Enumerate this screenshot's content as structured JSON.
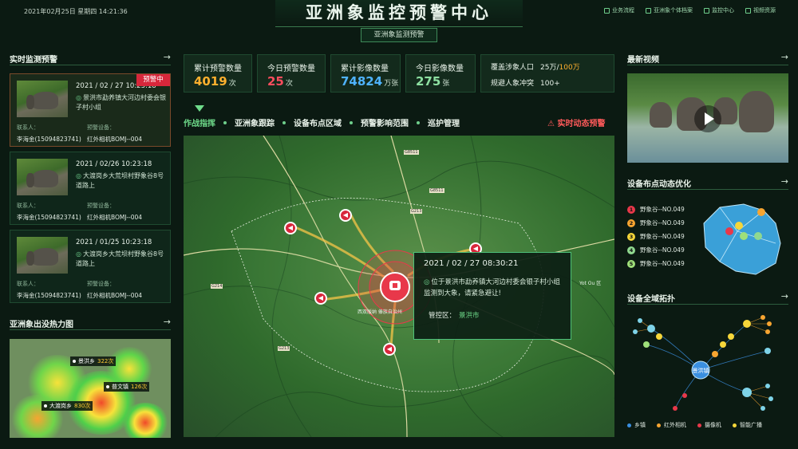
{
  "header": {
    "datetime": "2021年02月25日 星期四 14:21:36",
    "title": "亚洲象监控预警中心",
    "subtitle": "亚洲象监测预警",
    "links": [
      "业务流程",
      "亚洲象个体档案",
      "监控中心",
      "视频资源"
    ]
  },
  "left": {
    "alerts_title": "实时监测预警",
    "alerts": [
      {
        "date": "2021 / 02 / 27  10:23:18",
        "badge": "预警中",
        "location": "景洪市勐养镇大河边村委会银子村小组",
        "contact_label": "联系人：",
        "contact": "李海金(15094823741)",
        "device_label": "预警设备：",
        "device": "红外相机BOMJ--004"
      },
      {
        "date": "2021 / 02/26  10:23:18",
        "badge": "",
        "location": "大渡岗乡大荒坝村野象谷8号道路上",
        "contact_label": "联系人：",
        "contact": "李海金(15094823741)",
        "device_label": "预警设备：",
        "device": "红外相机BOMJ--004"
      },
      {
        "date": "2021 / 01/25  10:23:18",
        "badge": "",
        "location": "大渡岗乡大荒坝村野象谷8号道路上",
        "contact_label": "联系人：",
        "contact": "李海金(15094823741)",
        "device_label": "预警设备：",
        "device": "红外相机BOMJ--004"
      }
    ],
    "heat_title": "亚洲象出没热力图",
    "heat_tags": [
      {
        "name": "景洪乡",
        "count": "322次"
      },
      {
        "name": "普文镇",
        "count": "126次"
      },
      {
        "name": "大渡岗乡",
        "count": "830次"
      }
    ]
  },
  "stats": [
    {
      "label": "累计预警数量",
      "value": "4019",
      "unit": "次",
      "color": "orange"
    },
    {
      "label": "今日预警数量",
      "value": "25",
      "unit": "次",
      "color": "red"
    },
    {
      "label": "累计影像数量",
      "value": "74824",
      "unit": "万张",
      "color": "blue"
    },
    {
      "label": "今日影像数量",
      "value": "275",
      "unit": "张",
      "color": "green"
    }
  ],
  "coverage": {
    "row1_label": "覆盖涉象人口",
    "row1_value": "25万",
    "row1_total": "100万",
    "row2_label": "规避人象冲突",
    "row2_value": "100+"
  },
  "tabs": [
    "作战指挥",
    "亚洲象跟踪",
    "设备布点区域",
    "预警影响范围",
    "巡护管理"
  ],
  "realtime_label": "实时动态预警",
  "popup": {
    "date": "2021 / 02 / 27  08:30:21",
    "message": "位于景洪市勐养镇大河边村委会银子村小组监测到大象，请紧急避让!",
    "zone_label": "管控区：",
    "zone_value": "景洪市"
  },
  "map_labels": {
    "city": "西双版纳 傣族自治州",
    "town": "Yot Ou 区"
  },
  "right": {
    "video_title": "最新视频",
    "devices_title": "设备布点动态优化",
    "devices": [
      {
        "num": "1",
        "name": "野象谷--NO.049",
        "color": "#e8384a"
      },
      {
        "num": "2",
        "name": "野象谷--NO.049",
        "color": "#f7a531"
      },
      {
        "num": "3",
        "name": "野象谷--NO.049",
        "color": "#f5d63a"
      },
      {
        "num": "4",
        "name": "野象谷--NO.049",
        "color": "#8fd88f"
      },
      {
        "num": "5",
        "name": "野象谷--NO.049",
        "color": "#9fe07a"
      }
    ],
    "topology_title": "设备全域拓扑",
    "topology_center": "景洪镇",
    "legend": [
      {
        "label": "乡镇",
        "color": "#3a8fe0"
      },
      {
        "label": "红外相机",
        "color": "#f7a531"
      },
      {
        "label": "摄像机",
        "color": "#e8384a"
      },
      {
        "label": "智能广播",
        "color": "#f5d63a"
      }
    ]
  }
}
